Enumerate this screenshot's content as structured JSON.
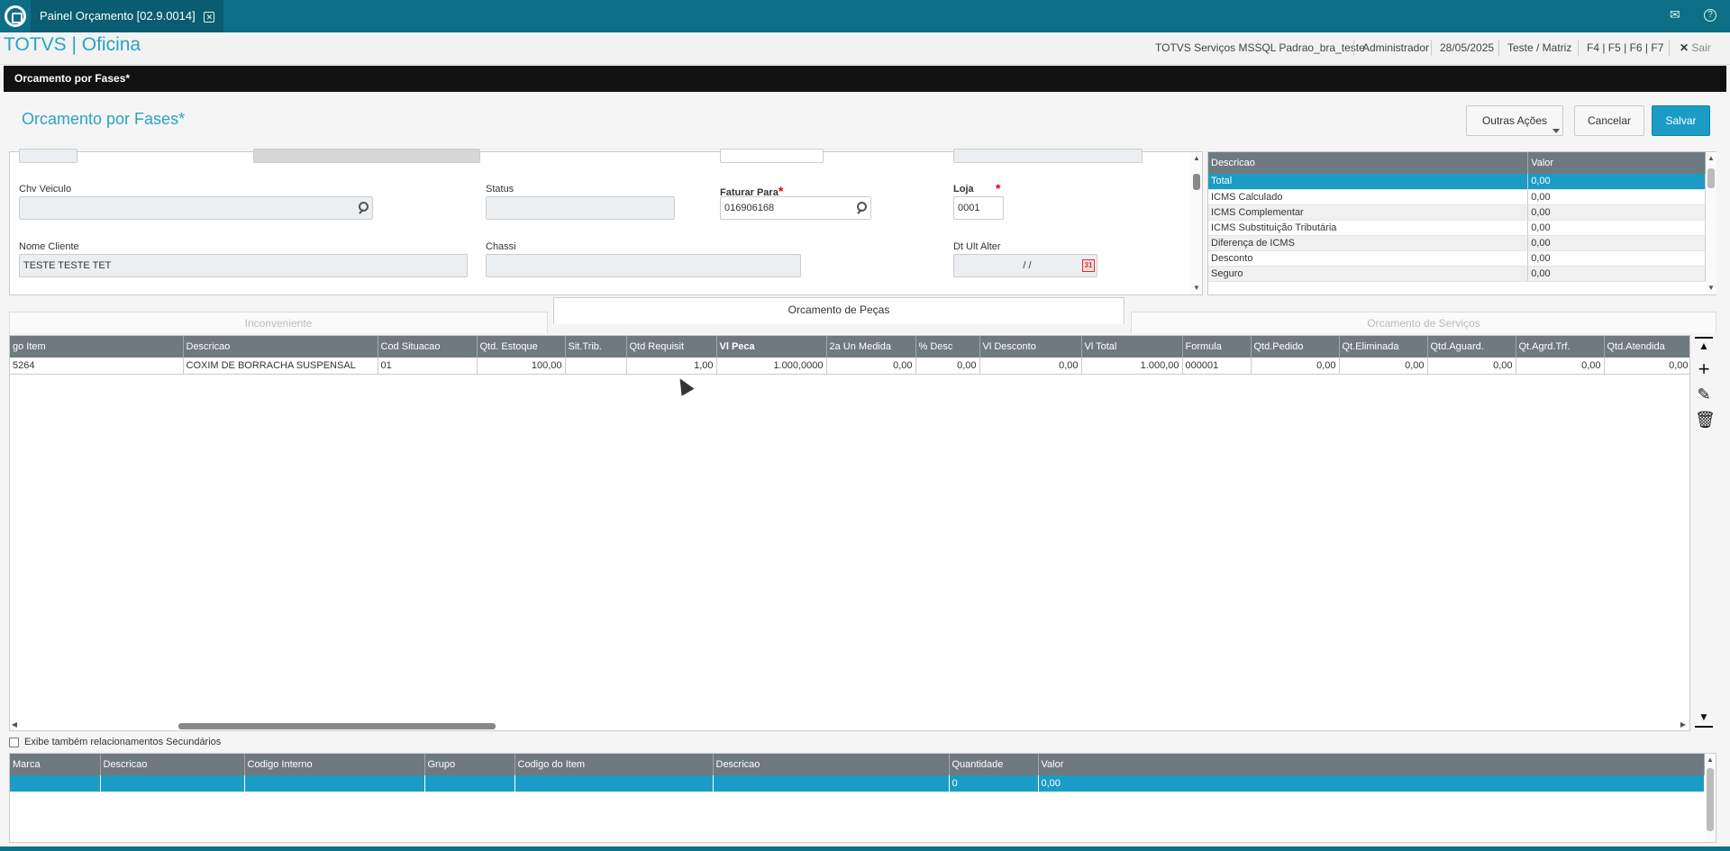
{
  "window": {
    "app_tab": "Painel Orçamento [02.9.0014]",
    "close_glyph": "✕",
    "mail_glyph": "✉",
    "help_glyph": "?"
  },
  "header": {
    "brand": "TOTVS | Oficina",
    "environment": "TOTVS Serviços MSSQL Padrao_bra_teste",
    "user": "Administrador",
    "date": "28/05/2025",
    "branch": "Teste / Matriz",
    "shortcuts": "F4 | F5 | F6 | F7",
    "exit_label": "Sair",
    "exit_glyph": "✕"
  },
  "routine_bar": "Orcamento por Fases*",
  "page": {
    "title": "Orcamento por Fases*",
    "actions": {
      "other": "Outras Ações",
      "cancel": "Cancelar",
      "save": "Salvar"
    }
  },
  "form": {
    "chv_veiculo_label": "Chv Veiculo",
    "chv_veiculo_value": "",
    "status_label": "Status",
    "status_value": "",
    "faturar_para_label": "Faturar Para",
    "faturar_para_value": "016906168",
    "loja_label": "Loja",
    "loja_value": "0001",
    "nome_cliente_label": "Nome Cliente",
    "nome_cliente_value": "TESTE TESTE TET",
    "chassi_label": "Chassi",
    "chassi_value": "",
    "dt_ult_alter_label": "Dt Ult Alter",
    "dt_ult_alter_value": "/ /",
    "required_mark": "*"
  },
  "summary": {
    "headers": [
      "Descricao",
      "Valor"
    ],
    "rows": [
      {
        "desc": "Total",
        "valor": "0,00"
      },
      {
        "desc": "ICMS Calculado",
        "valor": "0,00"
      },
      {
        "desc": "ICMS Complementar",
        "valor": "0,00"
      },
      {
        "desc": "ICMS Substituição Tributária",
        "valor": "0,00"
      },
      {
        "desc": "Diferença de ICMS",
        "valor": "0,00"
      },
      {
        "desc": "Desconto",
        "valor": "0,00"
      },
      {
        "desc": "Seguro",
        "valor": "0,00"
      }
    ]
  },
  "tabs": [
    "Inconveniente",
    "Orcamento de Peças",
    "Orcamento de Serviços"
  ],
  "grid": {
    "headers": [
      "go Item",
      "Descricao",
      "Cod Situacao",
      "Qtd. Estoque",
      "Sit.Trib.",
      "Qtd Requisit",
      "Vl Peca",
      "2a Un Medida",
      "% Desc",
      "Vl Desconto",
      "Vl Total",
      "Formula",
      "Qtd.Pedido",
      "Qt.Eliminada",
      "Qtd.Aguard.",
      "Qt.Agrd.Trf.",
      "Qtd.Atendida"
    ],
    "row": [
      "5264",
      "COXIM DE BORRACHA SUSPENSAL",
      "01",
      "100,00",
      "",
      "1,00",
      "1.000,0000",
      "0,00",
      "0,00",
      "0,00",
      "1.000,00",
      "000001",
      "0,00",
      "0,00",
      "0,00",
      "0,00",
      "0,00"
    ]
  },
  "checkbox_label": "Exibe também relacionamentos Secundários",
  "bottom_grid": {
    "headers": [
      "Marca",
      "Descricao",
      "Codigo Interno",
      "Grupo",
      "Codigo do Item",
      "Descricao",
      "Quantidade",
      "Valor"
    ],
    "row": [
      "",
      "",
      "",
      "",
      "",
      "",
      "0",
      "0,00"
    ]
  }
}
